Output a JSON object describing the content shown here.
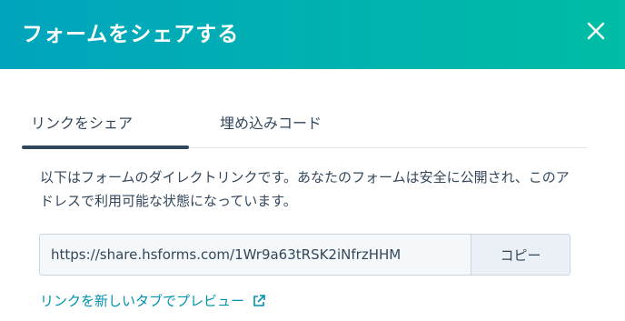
{
  "dialog": {
    "title": "フォームをシェアする",
    "close_icon": "close-icon"
  },
  "tabs": [
    {
      "label": "リンクをシェア",
      "active": true
    },
    {
      "label": "埋め込みコード",
      "active": false
    }
  ],
  "share": {
    "description": "以下はフォームのダイレクトリンクです。あなたのフォームは安全に公開され、このアドレスで利用可能な状態になっています。",
    "url": "https://share.hsforms.com/1Wr9a63tRSK2iNfrzHHM",
    "copy_label": "コピー",
    "preview_link": "リンクを新しいタブでプレビュー",
    "preview_icon": "external-link-icon"
  },
  "colors": {
    "header_start": "#00a4bd",
    "header_end": "#00bda5",
    "text": "#33475b",
    "link": "#0091ae"
  }
}
